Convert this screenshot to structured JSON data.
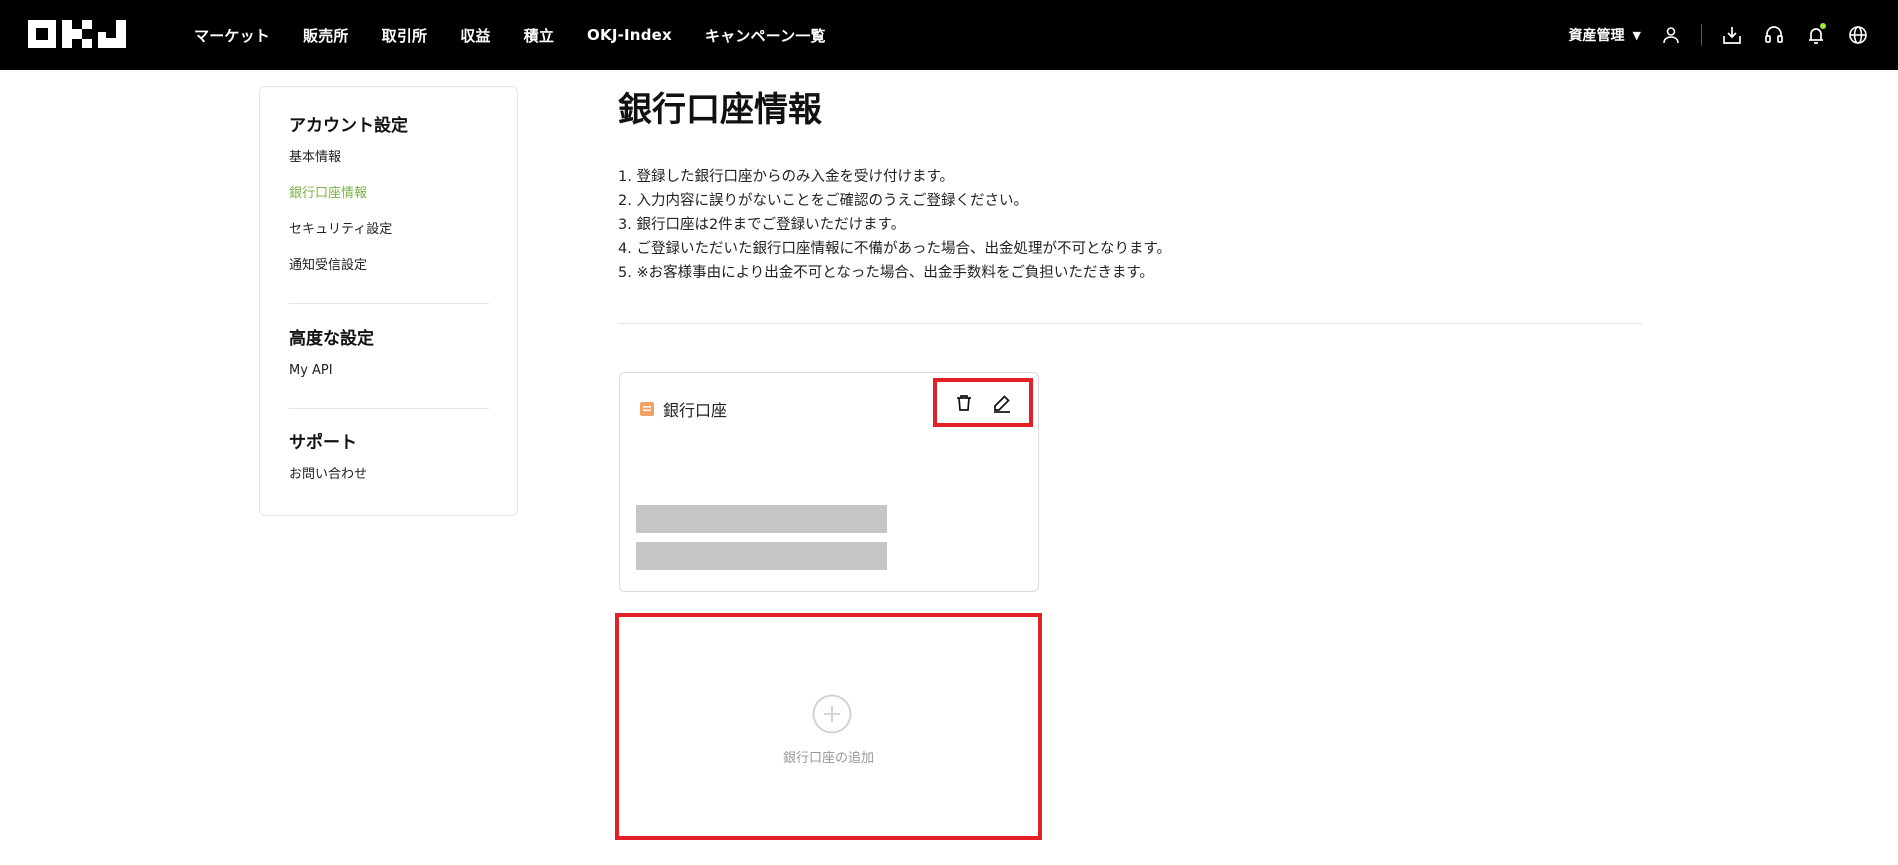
{
  "header": {
    "logo_text": "OKJ",
    "nav": [
      "マーケット",
      "販売所",
      "取引所",
      "収益",
      "積立",
      "OKJ-Index",
      "キャンペーン一覧"
    ],
    "asset_menu": "資産管理",
    "icons": [
      "user-icon",
      "download-icon",
      "headset-icon",
      "bell-icon",
      "globe-icon"
    ]
  },
  "sidebar": {
    "sections": [
      {
        "title": "アカウント設定",
        "items": [
          "基本情報",
          "銀行口座情報",
          "セキュリティ設定",
          "通知受信設定"
        ]
      },
      {
        "title": "高度な設定",
        "items": [
          "My API"
        ]
      },
      {
        "title": "サポート",
        "items": [
          "お問い合わせ"
        ]
      }
    ],
    "active_item": "銀行口座情報"
  },
  "main": {
    "title": "銀行口座情報",
    "notes": [
      "1. 登録した銀行口座からのみ入金を受け付けます。",
      "2. 入力内容に誤りがないことをご確認のうえご登録ください。",
      "3. 銀行口座は2件までご登録いただけます。",
      "4. ご登録いただいた銀行口座情報に不備があった場合、出金処理が不可となります。",
      "5. ※お客様事由により出金不可となった場合、出金手数料をご負担いただきます。"
    ],
    "bank_card": {
      "title": "銀行口座"
    },
    "add_label": "銀行口座の追加"
  },
  "colors": {
    "header_bg": "#000000",
    "active": "#7cb342",
    "highlight": "#e32027",
    "masked": "#c6c6c6",
    "notify_dot": "#a3e635",
    "bank_icon": "#f4a261"
  }
}
